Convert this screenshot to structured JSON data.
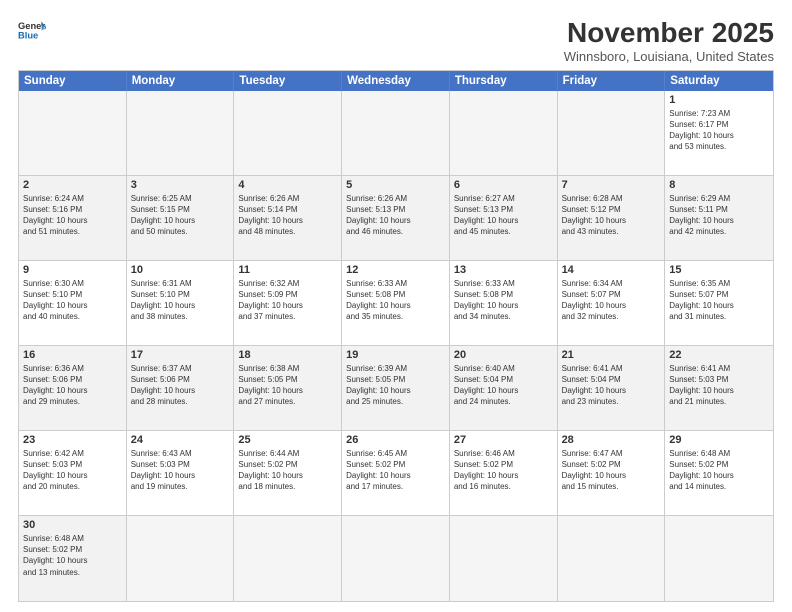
{
  "header": {
    "logo_general": "General",
    "logo_blue": "Blue",
    "month_title": "November 2025",
    "location": "Winnsboro, Louisiana, United States"
  },
  "day_headers": [
    "Sunday",
    "Monday",
    "Tuesday",
    "Wednesday",
    "Thursday",
    "Friday",
    "Saturday"
  ],
  "cells": [
    {
      "day": "",
      "info": "",
      "empty": true
    },
    {
      "day": "",
      "info": "",
      "empty": true
    },
    {
      "day": "",
      "info": "",
      "empty": true
    },
    {
      "day": "",
      "info": "",
      "empty": true
    },
    {
      "day": "",
      "info": "",
      "empty": true
    },
    {
      "day": "",
      "info": "",
      "empty": true
    },
    {
      "day": "1",
      "info": "Sunrise: 7:23 AM\nSunset: 6:17 PM\nDaylight: 10 hours\nand 53 minutes.",
      "empty": false
    },
    {
      "day": "2",
      "info": "Sunrise: 6:24 AM\nSunset: 5:16 PM\nDaylight: 10 hours\nand 51 minutes.",
      "empty": false
    },
    {
      "day": "3",
      "info": "Sunrise: 6:25 AM\nSunset: 5:15 PM\nDaylight: 10 hours\nand 50 minutes.",
      "empty": false
    },
    {
      "day": "4",
      "info": "Sunrise: 6:26 AM\nSunset: 5:14 PM\nDaylight: 10 hours\nand 48 minutes.",
      "empty": false
    },
    {
      "day": "5",
      "info": "Sunrise: 6:26 AM\nSunset: 5:13 PM\nDaylight: 10 hours\nand 46 minutes.",
      "empty": false
    },
    {
      "day": "6",
      "info": "Sunrise: 6:27 AM\nSunset: 5:13 PM\nDaylight: 10 hours\nand 45 minutes.",
      "empty": false
    },
    {
      "day": "7",
      "info": "Sunrise: 6:28 AM\nSunset: 5:12 PM\nDaylight: 10 hours\nand 43 minutes.",
      "empty": false
    },
    {
      "day": "8",
      "info": "Sunrise: 6:29 AM\nSunset: 5:11 PM\nDaylight: 10 hours\nand 42 minutes.",
      "empty": false
    },
    {
      "day": "9",
      "info": "Sunrise: 6:30 AM\nSunset: 5:10 PM\nDaylight: 10 hours\nand 40 minutes.",
      "empty": false
    },
    {
      "day": "10",
      "info": "Sunrise: 6:31 AM\nSunset: 5:10 PM\nDaylight: 10 hours\nand 38 minutes.",
      "empty": false
    },
    {
      "day": "11",
      "info": "Sunrise: 6:32 AM\nSunset: 5:09 PM\nDaylight: 10 hours\nand 37 minutes.",
      "empty": false
    },
    {
      "day": "12",
      "info": "Sunrise: 6:33 AM\nSunset: 5:08 PM\nDaylight: 10 hours\nand 35 minutes.",
      "empty": false
    },
    {
      "day": "13",
      "info": "Sunrise: 6:33 AM\nSunset: 5:08 PM\nDaylight: 10 hours\nand 34 minutes.",
      "empty": false
    },
    {
      "day": "14",
      "info": "Sunrise: 6:34 AM\nSunset: 5:07 PM\nDaylight: 10 hours\nand 32 minutes.",
      "empty": false
    },
    {
      "day": "15",
      "info": "Sunrise: 6:35 AM\nSunset: 5:07 PM\nDaylight: 10 hours\nand 31 minutes.",
      "empty": false
    },
    {
      "day": "16",
      "info": "Sunrise: 6:36 AM\nSunset: 5:06 PM\nDaylight: 10 hours\nand 29 minutes.",
      "empty": false
    },
    {
      "day": "17",
      "info": "Sunrise: 6:37 AM\nSunset: 5:06 PM\nDaylight: 10 hours\nand 28 minutes.",
      "empty": false
    },
    {
      "day": "18",
      "info": "Sunrise: 6:38 AM\nSunset: 5:05 PM\nDaylight: 10 hours\nand 27 minutes.",
      "empty": false
    },
    {
      "day": "19",
      "info": "Sunrise: 6:39 AM\nSunset: 5:05 PM\nDaylight: 10 hours\nand 25 minutes.",
      "empty": false
    },
    {
      "day": "20",
      "info": "Sunrise: 6:40 AM\nSunset: 5:04 PM\nDaylight: 10 hours\nand 24 minutes.",
      "empty": false
    },
    {
      "day": "21",
      "info": "Sunrise: 6:41 AM\nSunset: 5:04 PM\nDaylight: 10 hours\nand 23 minutes.",
      "empty": false
    },
    {
      "day": "22",
      "info": "Sunrise: 6:41 AM\nSunset: 5:03 PM\nDaylight: 10 hours\nand 21 minutes.",
      "empty": false
    },
    {
      "day": "23",
      "info": "Sunrise: 6:42 AM\nSunset: 5:03 PM\nDaylight: 10 hours\nand 20 minutes.",
      "empty": false
    },
    {
      "day": "24",
      "info": "Sunrise: 6:43 AM\nSunset: 5:03 PM\nDaylight: 10 hours\nand 19 minutes.",
      "empty": false
    },
    {
      "day": "25",
      "info": "Sunrise: 6:44 AM\nSunset: 5:02 PM\nDaylight: 10 hours\nand 18 minutes.",
      "empty": false
    },
    {
      "day": "26",
      "info": "Sunrise: 6:45 AM\nSunset: 5:02 PM\nDaylight: 10 hours\nand 17 minutes.",
      "empty": false
    },
    {
      "day": "27",
      "info": "Sunrise: 6:46 AM\nSunset: 5:02 PM\nDaylight: 10 hours\nand 16 minutes.",
      "empty": false
    },
    {
      "day": "28",
      "info": "Sunrise: 6:47 AM\nSunset: 5:02 PM\nDaylight: 10 hours\nand 15 minutes.",
      "empty": false
    },
    {
      "day": "29",
      "info": "Sunrise: 6:48 AM\nSunset: 5:02 PM\nDaylight: 10 hours\nand 14 minutes.",
      "empty": false
    },
    {
      "day": "30",
      "info": "Sunrise: 6:48 AM\nSunset: 5:02 PM\nDaylight: 10 hours\nand 13 minutes.",
      "empty": false
    },
    {
      "day": "",
      "info": "",
      "empty": true
    },
    {
      "day": "",
      "info": "",
      "empty": true
    },
    {
      "day": "",
      "info": "",
      "empty": true
    },
    {
      "day": "",
      "info": "",
      "empty": true
    },
    {
      "day": "",
      "info": "",
      "empty": true
    },
    {
      "day": "",
      "info": "",
      "empty": true
    }
  ]
}
